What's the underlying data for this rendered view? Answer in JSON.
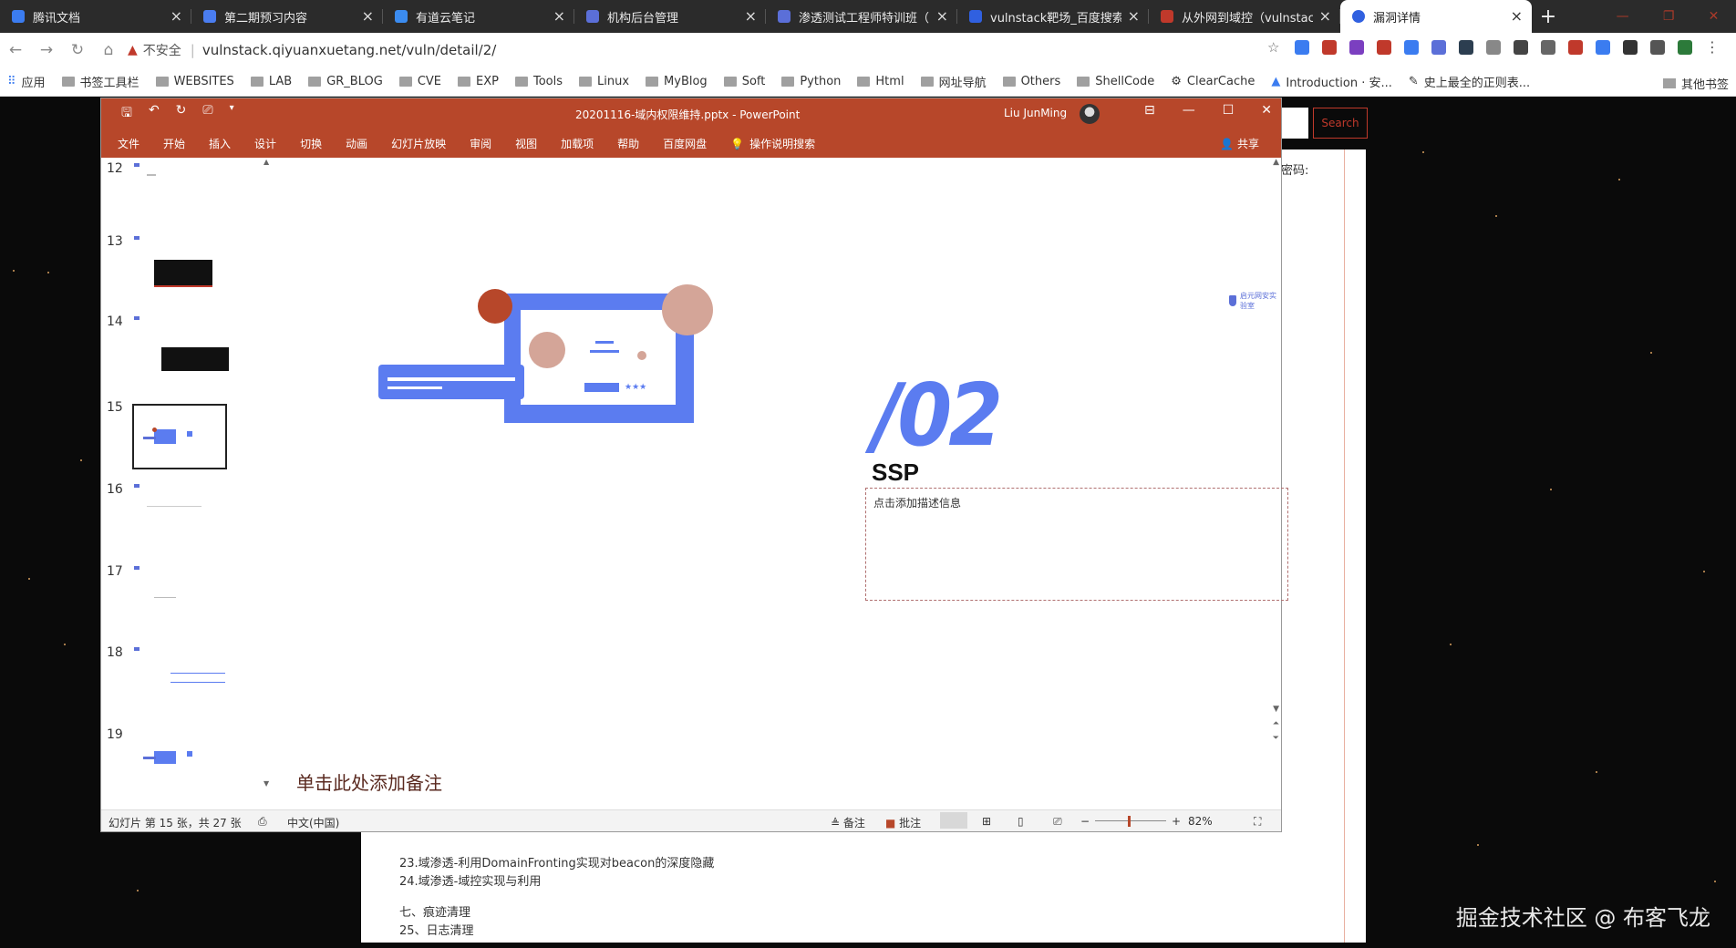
{
  "tabs": [
    {
      "title": "腾讯文档",
      "color": "#3b7cf0"
    },
    {
      "title": "第二期预习内容",
      "color": "#4a7df0"
    },
    {
      "title": "有道云笔记",
      "color": "#3b8cf0"
    },
    {
      "title": "机构后台管理",
      "color": "#5b6fd8"
    },
    {
      "title": "渗透测试工程师特训班（K",
      "color": "#5b6fd8"
    },
    {
      "title": "vulnstack靶场_百度搜索",
      "color": "#3060e0"
    },
    {
      "title": "从外网到域控（vulnstack",
      "color": "#c0392b"
    },
    {
      "title": "漏洞详情",
      "color": "#3060e0",
      "active": true
    }
  ],
  "address": {
    "security_label": "不安全",
    "url": "vulnstack.qiyuanxuetang.net/vuln/detail/2/"
  },
  "bookmarks": [
    "应用",
    "书签工具栏",
    "WEBSITES",
    "LAB",
    "GR_BLOG",
    "CVE",
    "EXP",
    "Tools",
    "Linux",
    "MyBlog",
    "Soft",
    "Python",
    "Html",
    "网址导航",
    "Others",
    "ShellCode",
    "ClearCache",
    "Introduction · 安...",
    "史上最全的正则表..."
  ],
  "bookmarks_other": "其他书签",
  "web": {
    "search_button": "Search",
    "password_label": "密码:",
    "lines": [
      "23.域渗透-利用DomainFronting实现对beacon的深度隐藏",
      "24.域渗透-域控实现与利用",
      "七、痕迹清理",
      "25、日志清理"
    ]
  },
  "ppt": {
    "doc_title": "20201116-域内权限维持.pptx  -  PowerPoint",
    "user": "Liu JunMing",
    "ribbon_tabs": [
      "文件",
      "开始",
      "插入",
      "设计",
      "切换",
      "动画",
      "幻灯片放映",
      "审阅",
      "视图",
      "加载项",
      "帮助",
      "百度网盘"
    ],
    "tell_me": "操作说明搜索",
    "share": "共享",
    "thumbnails": [
      "12",
      "13",
      "14",
      "15",
      "16",
      "17",
      "18",
      "19"
    ],
    "selected_slide": "15",
    "slide": {
      "number": "/02",
      "title": "SSP",
      "desc_placeholder": "点击添加描述信息",
      "logo_text": "启元网安实验室"
    },
    "notes_placeholder": "单击此处添加备注",
    "status": {
      "slide_count": "幻灯片 第 15 张，共 27 张",
      "language": "中文(中国)",
      "notes_btn": "备注",
      "comments_btn": "批注",
      "zoom": "82%"
    },
    "colors": {
      "accent": "#b7472a",
      "blue": "#5b7cf0",
      "peach": "#d4a598",
      "red": "#b7472a"
    }
  },
  "watermark": "掘金技术社区 @ 布客飞龙"
}
